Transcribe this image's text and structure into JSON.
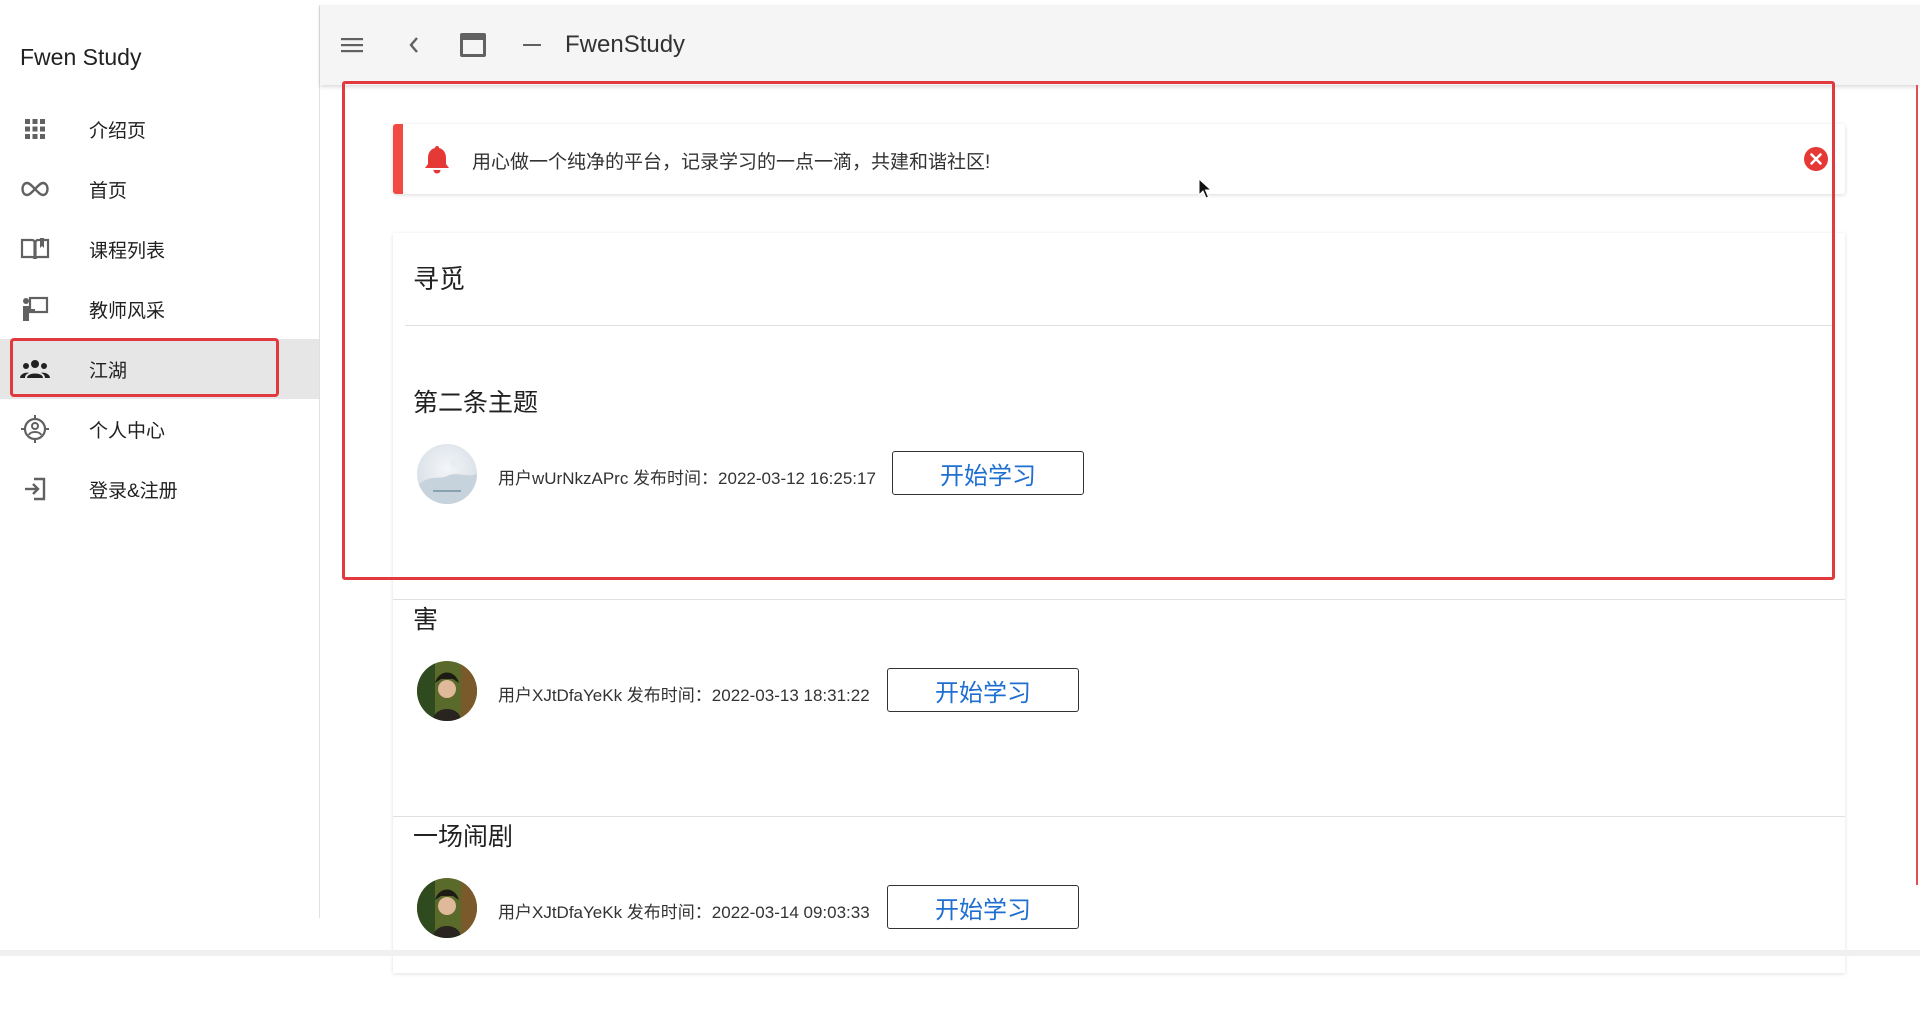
{
  "sidebar": {
    "brand": "Fwen Study",
    "items": [
      {
        "label": "介绍页",
        "icon": "apps-grid-icon",
        "active": false
      },
      {
        "label": "首页",
        "icon": "infinity-icon",
        "active": false
      },
      {
        "label": "课程列表",
        "icon": "book-open-icon",
        "active": false
      },
      {
        "label": "教师风采",
        "icon": "teacher-icon",
        "active": false
      },
      {
        "label": "江湖",
        "icon": "people-group-icon",
        "active": true
      },
      {
        "label": "个人中心",
        "icon": "account-circle-icon",
        "active": false
      },
      {
        "label": "登录&注册",
        "icon": "login-icon",
        "active": false
      }
    ]
  },
  "topbar": {
    "title": "FwenStudy",
    "icons": [
      "menu-icon",
      "chevron-left-icon",
      "window-icon",
      "minimize-icon"
    ]
  },
  "notice": {
    "text": "用心做一个纯净的平台，记录学习的一点一滴，共建和谐社区!",
    "icon": "bell-icon",
    "close_icon": "close-circle-icon"
  },
  "card": {
    "title": "寻觅",
    "posts": [
      {
        "title": "第二条主题",
        "meta": "用户wUrNkzAPrc 发布时间：2022-03-12 16:25:17",
        "button": "开始学习"
      },
      {
        "title": "害",
        "meta": "用户XJtDfaYeKk 发布时间：2022-03-13 18:31:22",
        "button": "开始学习"
      },
      {
        "title": "一场闹剧",
        "meta": "用户XJtDfaYeKk 发布时间：2022-03-14 09:03:33",
        "button": "开始学习"
      }
    ]
  },
  "colors": {
    "accent_red": "#e0393e",
    "button_text": "#1e6fd0",
    "notice_bar": "#f24a43"
  }
}
